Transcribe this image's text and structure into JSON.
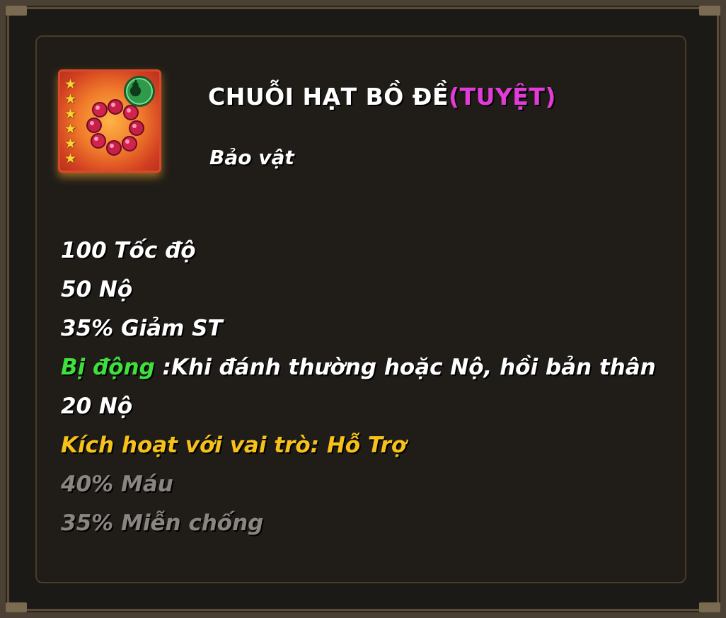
{
  "item": {
    "name": "CHUỖI HẠT BỒ ĐỀ",
    "grade": "(TUYỆT)",
    "type": "Bảo vật",
    "star_count": 6,
    "role_icon": "gourd-icon",
    "image_icon": "prayer-beads-icon"
  },
  "stats": [
    "100 Tốc độ",
    "50 Nộ",
    "35% Giảm ST"
  ],
  "passive": {
    "label": "Bị động",
    "text": " :Khi đánh thường hoặc Nộ, hồi bản thân",
    "text_cont": "20 Nộ"
  },
  "activation": {
    "text": "Kích hoạt với vai trò: Hỗ Trợ",
    "bonuses": [
      "40% Máu",
      "35% Miễn chống"
    ]
  },
  "colors": {
    "grade": "#e23bd8",
    "passive_label": "#3ee03e",
    "activation": "#f6c21a",
    "inactive_bonus": "#8a8580"
  }
}
